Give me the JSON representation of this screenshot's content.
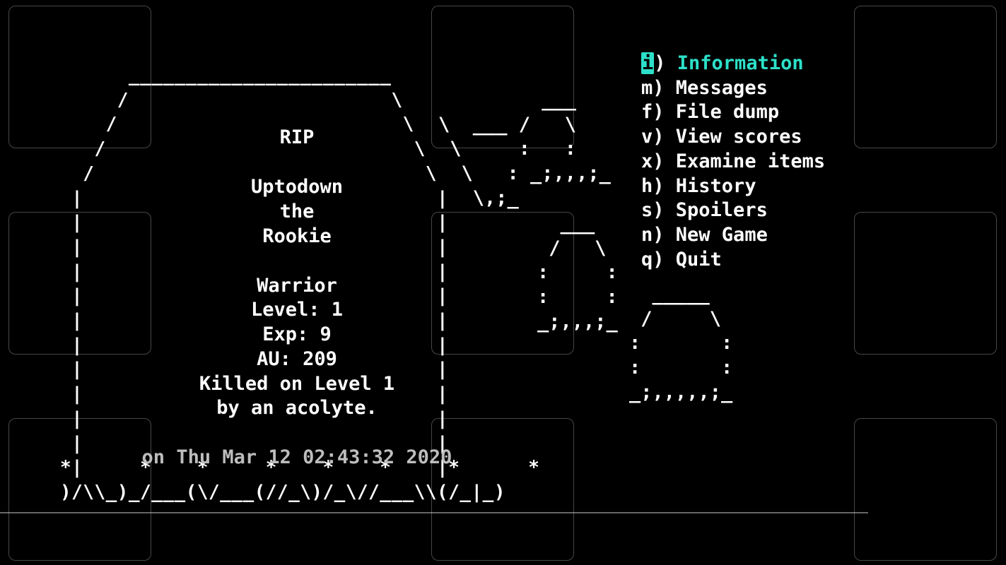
{
  "tombstone": {
    "header": "RIP",
    "name_line1": "Uptodown",
    "name_line2": "the",
    "name_line3": "Rookie",
    "class": "Warrior",
    "level": "Level: 1",
    "exp": "Exp: 9",
    "au": "AU: 209",
    "killed_line1": "Killed on Level 1",
    "killed_line2": "by an acolyte.",
    "date": "on Thu Mar 12 02:43:32 2020"
  },
  "ascii": {
    "tomb_left": "      _______________________\n     /                       \\\n    /                         \\\n   /                           \\\n  /                             \\\n |                               |\n |                               |\n |                               |\n |                               |\n |                               |\n |                               |\n |                               |\n |                               |\n |                               |\n |                               |\n |                               |\n*|     *    *     *    *    *    |*      *\n)/\\\\_)_/___(\\/___(//_\\)/_\\//___\\\\(/_|_)",
    "deco1": "         ___\n\\  ___ /   \\\n \\     :   :\n  \\   : _;,,,;_\n   \\,;_",
    "deco2": "  ___\n /   \\\n:     :\n:     :\n_;,,,;_",
    "deco3": "  _____\n /     \\\n:       :\n:       :\n_;,,,,,;_"
  },
  "menu": {
    "selected_index": 0,
    "items": [
      {
        "key": "i",
        "label": "Information"
      },
      {
        "key": "m",
        "label": "Messages"
      },
      {
        "key": "f",
        "label": "File dump"
      },
      {
        "key": "v",
        "label": "View scores"
      },
      {
        "key": "x",
        "label": "Examine items"
      },
      {
        "key": "h",
        "label": "History"
      },
      {
        "key": "s",
        "label": "Spoilers"
      },
      {
        "key": "n",
        "label": "New Game"
      },
      {
        "key": "q",
        "label": "Quit"
      }
    ]
  }
}
